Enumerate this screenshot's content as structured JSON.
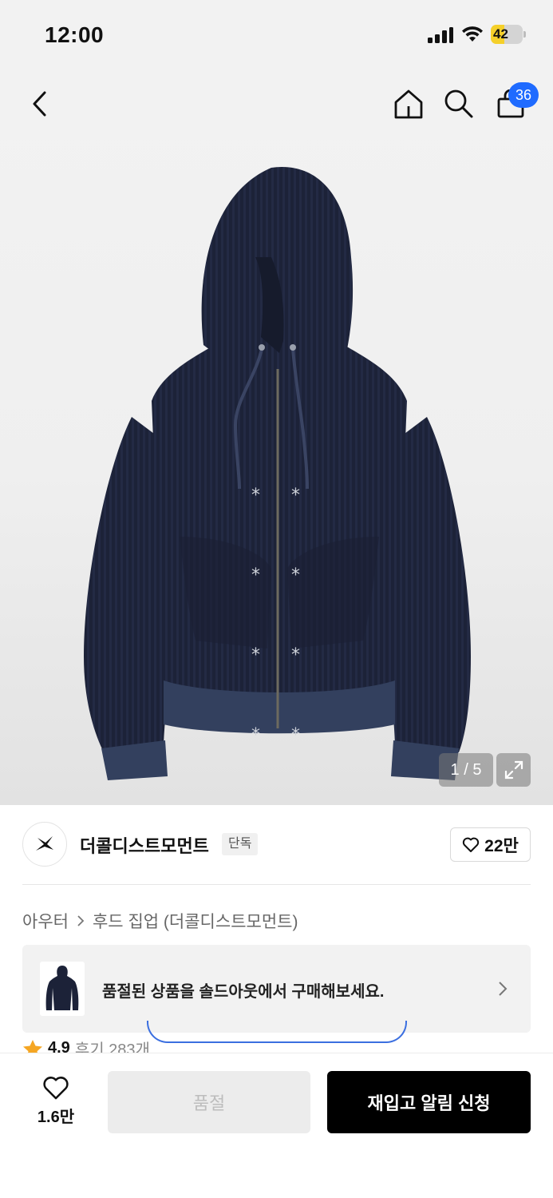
{
  "status_bar": {
    "time": "12:00",
    "battery": "42",
    "battery_level_percent": 42,
    "battery_color": "#f5d02a",
    "icons": [
      "signal-icon",
      "wifi-icon",
      "battery-charging-icon"
    ]
  },
  "header": {
    "icons": [
      "back-chevron-icon",
      "home-icon",
      "search-icon",
      "shopping-bag-icon"
    ],
    "cart_count": "36",
    "badge_color": "#1f6bff"
  },
  "gallery": {
    "counter": "1 / 5",
    "expand_icon": "expand-icon",
    "image": "navy waffle-knit zip-up hoodie with white asterisk embroidery"
  },
  "brand": {
    "name": "더콜디스트모먼트",
    "badge": "단독",
    "like_count": "22만",
    "logo_icon": "brand-star-logo-icon"
  },
  "breadcrumb": {
    "category": "아우터",
    "subcategory": "후드 집업 (더콜디스트모먼트)"
  },
  "soldout_banner": {
    "text": "품절된 상품을 솔드아웃에서 구매해보세요."
  },
  "rating": {
    "score": "4.9",
    "reviews": "후기 283개"
  },
  "bottom_bar": {
    "wish_count": "1.6만",
    "soldout_label": "품절",
    "restock_label": "재입고 알림 신청"
  }
}
